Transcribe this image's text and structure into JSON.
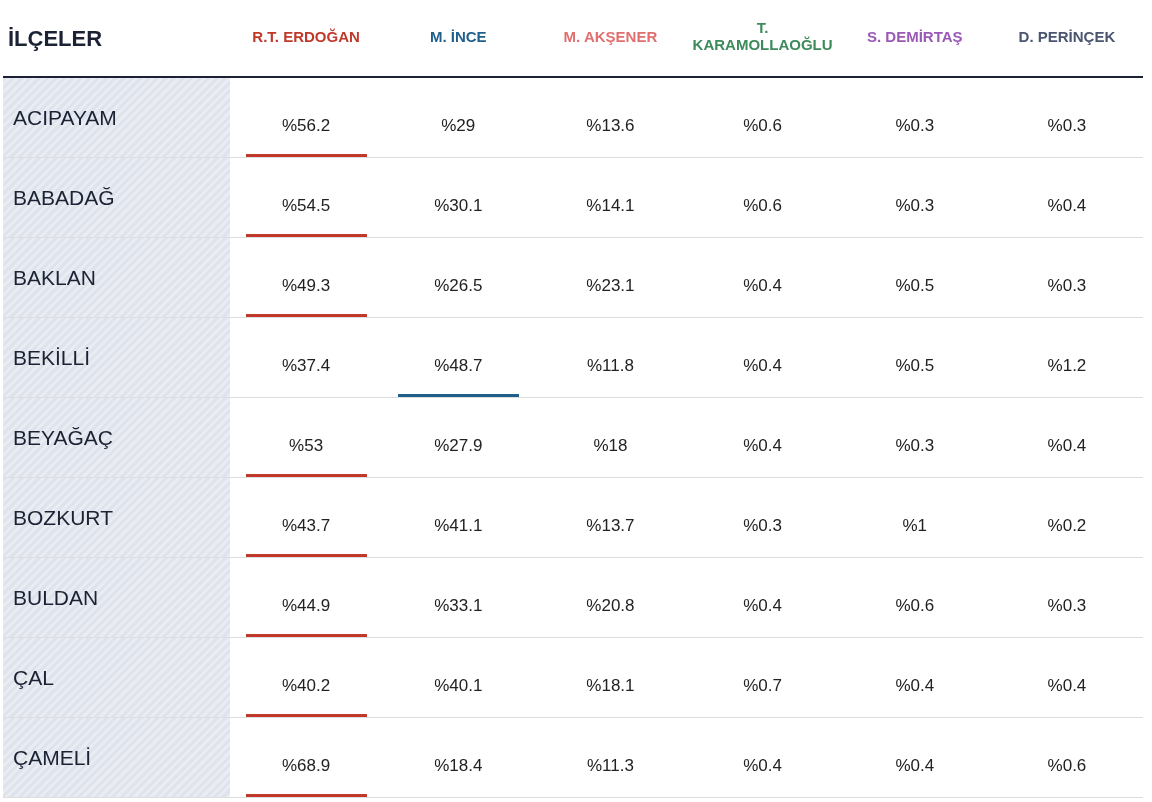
{
  "table": {
    "heading": "İLÇELER",
    "candidates": [
      {
        "name": "R.T. ERDOĞAN",
        "color": "#c0392b"
      },
      {
        "name": "M. İNCE",
        "color": "#1f5f8b"
      },
      {
        "name": "M. AKŞENER",
        "color": "#e07070"
      },
      {
        "name": "T. KARAMOLLAOĞLU",
        "color": "#3d8a5a"
      },
      {
        "name": "S. DEMİRTAŞ",
        "color": "#9b59b6"
      },
      {
        "name": "D. PERİNÇEK",
        "color": "#4a5570"
      }
    ],
    "rows": [
      {
        "district": "ACIPAYAM",
        "values": [
          {
            "text": "%56.2",
            "winner": true
          },
          {
            "text": "%29",
            "winner": false
          },
          {
            "text": "%13.6",
            "winner": false
          },
          {
            "text": "%0.6",
            "winner": false
          },
          {
            "text": "%0.3",
            "winner": false
          },
          {
            "text": "%0.3",
            "winner": false
          }
        ]
      },
      {
        "district": "BABADAĞ",
        "values": [
          {
            "text": "%54.5",
            "winner": true
          },
          {
            "text": "%30.1",
            "winner": false
          },
          {
            "text": "%14.1",
            "winner": false
          },
          {
            "text": "%0.6",
            "winner": false
          },
          {
            "text": "%0.3",
            "winner": false
          },
          {
            "text": "%0.4",
            "winner": false
          }
        ]
      },
      {
        "district": "BAKLAN",
        "values": [
          {
            "text": "%49.3",
            "winner": true
          },
          {
            "text": "%26.5",
            "winner": false
          },
          {
            "text": "%23.1",
            "winner": false
          },
          {
            "text": "%0.4",
            "winner": false
          },
          {
            "text": "%0.5",
            "winner": false
          },
          {
            "text": "%0.3",
            "winner": false
          }
        ]
      },
      {
        "district": "BEKİLLİ",
        "values": [
          {
            "text": "%37.4",
            "winner": false
          },
          {
            "text": "%48.7",
            "winner": true
          },
          {
            "text": "%11.8",
            "winner": false
          },
          {
            "text": "%0.4",
            "winner": false
          },
          {
            "text": "%0.5",
            "winner": false
          },
          {
            "text": "%1.2",
            "winner": false
          }
        ]
      },
      {
        "district": "BEYAĞAÇ",
        "values": [
          {
            "text": "%53",
            "winner": true
          },
          {
            "text": "%27.9",
            "winner": false
          },
          {
            "text": "%18",
            "winner": false
          },
          {
            "text": "%0.4",
            "winner": false
          },
          {
            "text": "%0.3",
            "winner": false
          },
          {
            "text": "%0.4",
            "winner": false
          }
        ]
      },
      {
        "district": "BOZKURT",
        "values": [
          {
            "text": "%43.7",
            "winner": true
          },
          {
            "text": "%41.1",
            "winner": false
          },
          {
            "text": "%13.7",
            "winner": false
          },
          {
            "text": "%0.3",
            "winner": false
          },
          {
            "text": "%1",
            "winner": false
          },
          {
            "text": "%0.2",
            "winner": false
          }
        ]
      },
      {
        "district": "BULDAN",
        "values": [
          {
            "text": "%44.9",
            "winner": true
          },
          {
            "text": "%33.1",
            "winner": false
          },
          {
            "text": "%20.8",
            "winner": false
          },
          {
            "text": "%0.4",
            "winner": false
          },
          {
            "text": "%0.6",
            "winner": false
          },
          {
            "text": "%0.3",
            "winner": false
          }
        ]
      },
      {
        "district": "ÇAL",
        "values": [
          {
            "text": "%40.2",
            "winner": true
          },
          {
            "text": "%40.1",
            "winner": false
          },
          {
            "text": "%18.1",
            "winner": false
          },
          {
            "text": "%0.7",
            "winner": false
          },
          {
            "text": "%0.4",
            "winner": false
          },
          {
            "text": "%0.4",
            "winner": false
          }
        ]
      },
      {
        "district": "ÇAMELİ",
        "values": [
          {
            "text": "%68.9",
            "winner": true
          },
          {
            "text": "%18.4",
            "winner": false
          },
          {
            "text": "%11.3",
            "winner": false
          },
          {
            "text": "%0.4",
            "winner": false
          },
          {
            "text": "%0.4",
            "winner": false
          },
          {
            "text": "%0.6",
            "winner": false
          }
        ]
      }
    ]
  }
}
